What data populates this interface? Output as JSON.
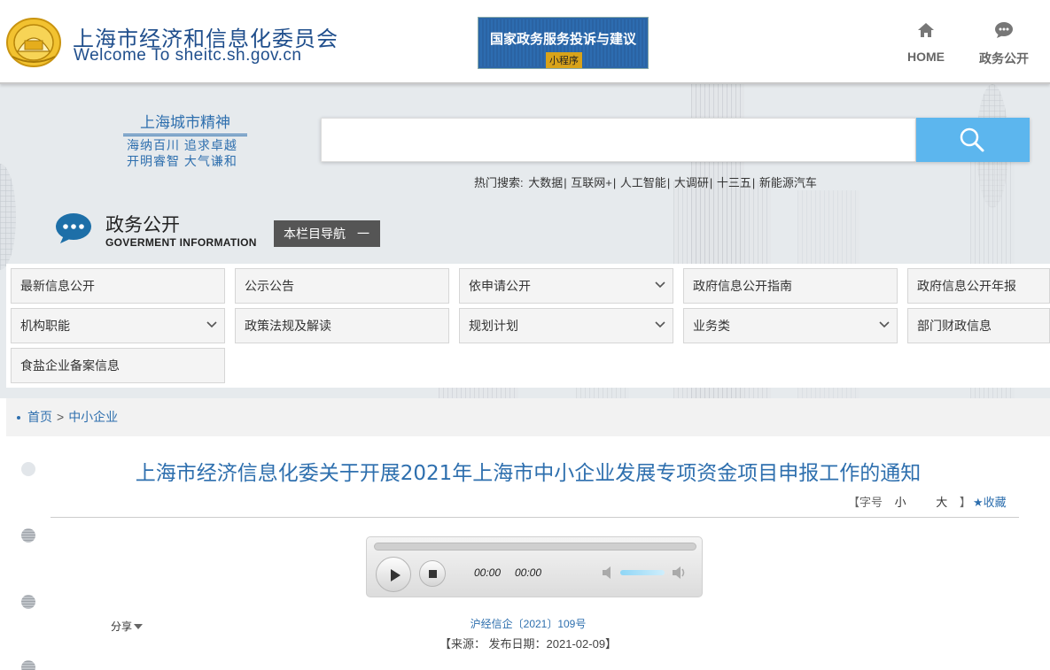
{
  "header": {
    "title": "上海市经济和信息化委员会",
    "subtitle": "Welcome To sheitc.sh.gov.cn",
    "banner_title": "国家政务服务投诉与建议",
    "banner_tag": "小程序",
    "nav": [
      {
        "label": "HOME",
        "icon": "home-icon"
      },
      {
        "label": "政务公开",
        "icon": "chat-bubble-icon"
      }
    ]
  },
  "hero": {
    "slogan_title": "上海城市精神",
    "slogan_line1": "海纳百川 追求卓越",
    "slogan_line2": "开明睿智 大气谦和",
    "search_placeholder": "",
    "hot_label": "热门搜索:",
    "hot_items": [
      "大数据",
      "互联网+",
      "人工智能",
      "大调研",
      "十三五",
      "新能源汽车"
    ],
    "section_title": "政务公开",
    "section_sub": "GOVERMENT INFORMATION",
    "nav_toggle": "本栏目导航",
    "nav_toggle_symbol": "一"
  },
  "menu": [
    {
      "label": "最新信息公开",
      "dropdown": false
    },
    {
      "label": "公示公告",
      "dropdown": false
    },
    {
      "label": "依申请公开",
      "dropdown": true
    },
    {
      "label": "政府信息公开指南",
      "dropdown": false
    },
    {
      "label": "政府信息公开年报",
      "dropdown": false
    },
    {
      "label": "机构职能",
      "dropdown": true
    },
    {
      "label": "政策法规及解读",
      "dropdown": false
    },
    {
      "label": "规划计划",
      "dropdown": true
    },
    {
      "label": "业务类",
      "dropdown": true
    },
    {
      "label": "部门财政信息",
      "dropdown": false
    },
    {
      "label": "食盐企业备案信息",
      "dropdown": false
    }
  ],
  "breadcrumb": {
    "home": "首页",
    "separator": ">",
    "current": "中小企业"
  },
  "article": {
    "title": "上海市经济信息化委关于开展2021年上海市中小企业发展专项资金项目申报工作的通知",
    "font_label": "【字号",
    "font_small": "小",
    "font_large": "大",
    "font_close": "】",
    "favorite": "★收藏",
    "player": {
      "current_time": "00:00",
      "total_time": "00:00"
    },
    "doc_number": "沪经信企〔2021〕109号",
    "meta_text": "【来源：  发布日期：2021-02-09】",
    "share": "分享"
  },
  "colors": {
    "brand_blue": "#1f4e8c",
    "link_blue": "#2e6fae",
    "search_button": "#5cb6ee",
    "toggle_bg": "#555555"
  }
}
